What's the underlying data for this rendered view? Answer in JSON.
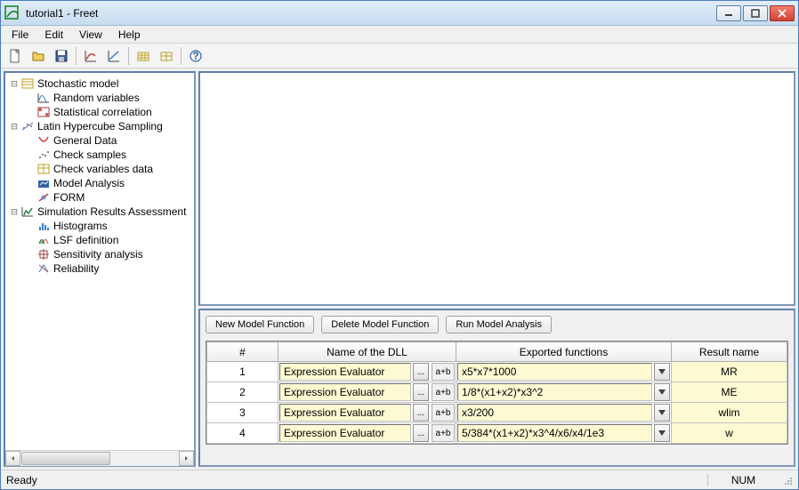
{
  "window": {
    "title": "tutorial1 - Freet"
  },
  "menu": {
    "file": "File",
    "edit": "Edit",
    "view": "View",
    "help": "Help"
  },
  "tree": {
    "n0": {
      "label": "Stochastic model"
    },
    "n0_0": {
      "label": "Random variables"
    },
    "n0_1": {
      "label": "Statistical correlation"
    },
    "n1": {
      "label": "Latin Hypercube Sampling"
    },
    "n1_0": {
      "label": "General Data"
    },
    "n1_1": {
      "label": "Check samples"
    },
    "n1_2": {
      "label": "Check variables data"
    },
    "n1_3": {
      "label": "Model Analysis"
    },
    "n1_4": {
      "label": "FORM"
    },
    "n2": {
      "label": "Simulation Results Assessment"
    },
    "n2_0": {
      "label": "Histograms"
    },
    "n2_1": {
      "label": "LSF definition"
    },
    "n2_2": {
      "label": "Sensitivity analysis"
    },
    "n2_3": {
      "label": "Reliability"
    }
  },
  "buttons": {
    "new_model": "New Model Function",
    "delete_model": "Delete Model Function",
    "run_model": "Run Model Analysis"
  },
  "grid": {
    "headers": {
      "num": "#",
      "dll": "Name of the DLL",
      "func": "Exported functions",
      "result": "Result name"
    },
    "dll_browse": "...",
    "dll_tag": "a+b",
    "rows": [
      {
        "num": "1",
        "dll": "Expression Evaluator",
        "func": "x5*x7*1000",
        "result": "MR"
      },
      {
        "num": "2",
        "dll": "Expression Evaluator",
        "func": "1/8*(x1+x2)*x3^2",
        "result": "ME"
      },
      {
        "num": "3",
        "dll": "Expression Evaluator",
        "func": "x3/200",
        "result": "wlim"
      },
      {
        "num": "4",
        "dll": "Expression Evaluator",
        "func": "5/384*(x1+x2)*x3^4/x6/x4/1e3",
        "result": "w"
      }
    ]
  },
  "status": {
    "left": "Ready",
    "right": "NUM"
  }
}
